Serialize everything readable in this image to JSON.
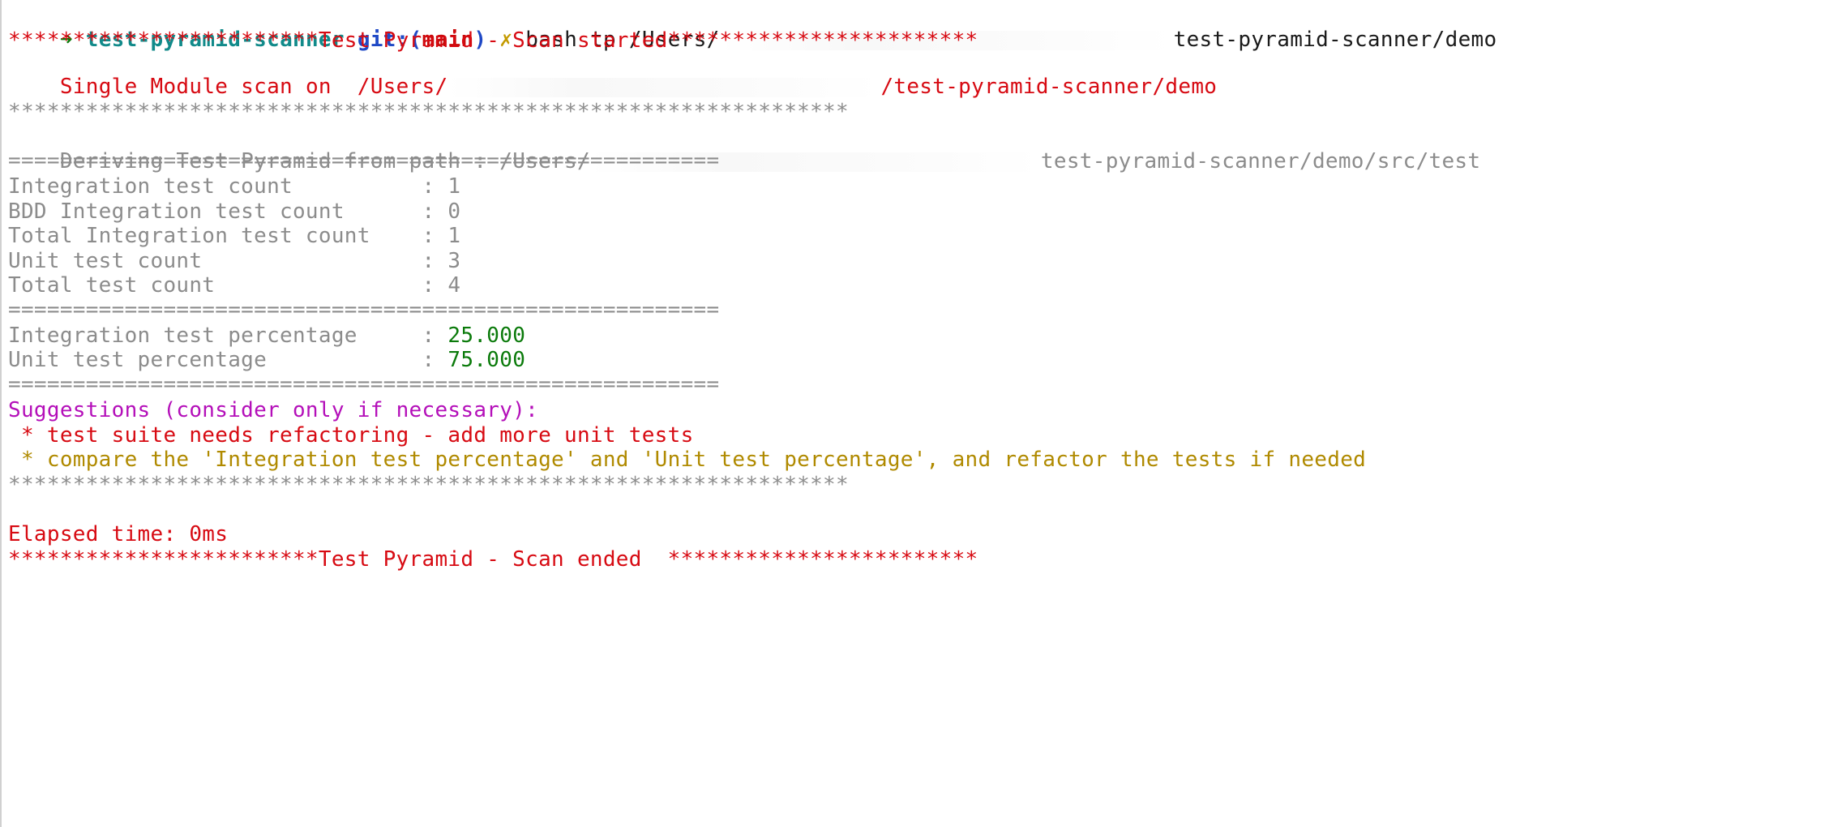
{
  "prompt": {
    "arrow": "➜",
    "directory": "test-pyramid-scanner",
    "git_prefix": "git:(",
    "branch": "main",
    "git_suffix": ")",
    "dirty_mark": "✗",
    "command": "bash tp /Users/",
    "command_tail": "test-pyramid-scanner/demo"
  },
  "output": {
    "scan_started": "************************Test Pyramid - Scan started************************",
    "single_module_prefix": "Single Module scan on  /Users/",
    "single_module_tail": "/test-pyramid-scanner/demo",
    "stars_top": "*****************************************************************",
    "deriving_prefix": "Deriving Test Pyramid from path : /Users/",
    "deriving_tail": "test-pyramid-scanner/demo/src/test",
    "separator": "=======================================================",
    "counts": [
      {
        "label": "Integration test count          : ",
        "value": "1"
      },
      {
        "label": "BDD Integration test count      : ",
        "value": "0"
      },
      {
        "label": "Total Integration test count    : ",
        "value": "1"
      },
      {
        "label": "Unit test count                 : ",
        "value": "3"
      },
      {
        "label": "Total test count                : ",
        "value": "4"
      }
    ],
    "percentages": [
      {
        "label": "Integration test percentage     : ",
        "value": "25.000"
      },
      {
        "label": "Unit test percentage            : ",
        "value": "75.000"
      }
    ],
    "suggestions_heading": "Suggestions (consider only if necessary):",
    "suggestion_1": " * test suite needs refactoring - add more unit tests",
    "suggestion_2": " * compare the 'Integration test percentage' and 'Unit test percentage', and refactor the tests if needed",
    "stars_bottom": "*****************************************************************",
    "elapsed": "Elapsed time: 0ms",
    "scan_ended": "************************Test Pyramid - Scan ended  ************************"
  },
  "colors": {
    "error_red": "#d70a12",
    "info_grey": "#8c8c8c",
    "value_green": "#0a7a0a",
    "heading_magenta": "#b40fb9",
    "warning_olive": "#b08a00"
  }
}
